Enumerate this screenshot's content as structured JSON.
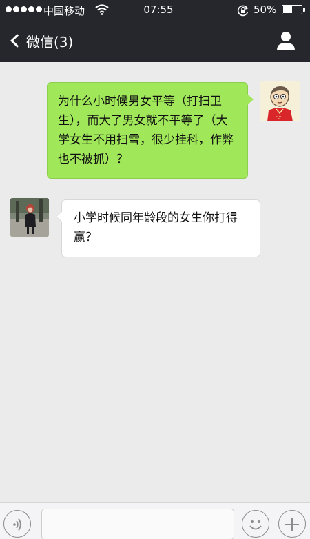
{
  "status_bar": {
    "carrier": "中国移动",
    "time": "07:55",
    "battery": "50%",
    "battery_level": 0.5
  },
  "nav": {
    "back_label": "微信(3)"
  },
  "messages": [
    {
      "direction": "sent",
      "text": "为什么小时候男女平等（打扫卫生），而大了男女就不平等了（大学女生不用扫雪，很少挂科，作弊也不被抓）？"
    },
    {
      "direction": "received",
      "text": "小学时候同年龄段的女生你打得赢？"
    }
  ],
  "input": {
    "value": "",
    "placeholder": ""
  },
  "colors": {
    "nav_background": "#26272c",
    "sent_bubble": "#a0e75a",
    "chat_background": "#ebebeb"
  }
}
